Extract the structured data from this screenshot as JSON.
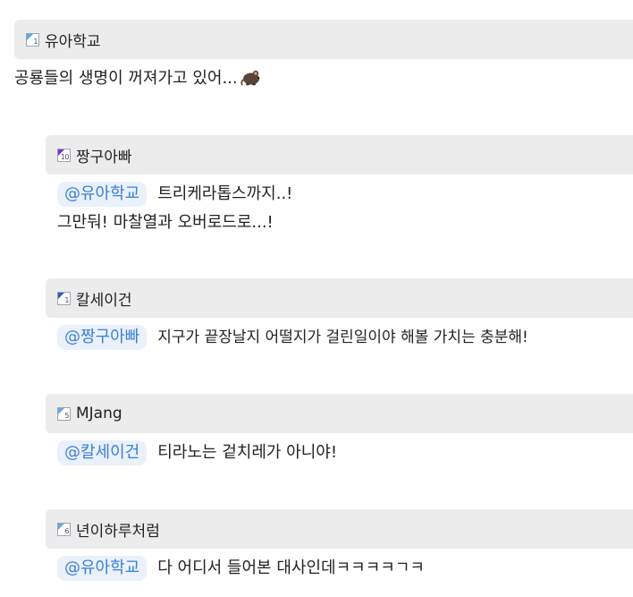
{
  "comments": [
    {
      "nick": "유아학교",
      "level": "1",
      "level_color": "#55aaee",
      "lines": [
        "공룡들의 생명이 꺼져가고 있어..."
      ],
      "emoji": "mouse-emoji"
    },
    {
      "nick": "짱구아빠",
      "level": "10",
      "level_color": "#7a2fd6",
      "mention": "@유아학교",
      "lines": [
        "트리케라톱스까지..!",
        "그만둬! 마찰열과 오버로드로...!"
      ]
    },
    {
      "nick": "칼세이건",
      "level": "1",
      "level_color": "#2f5fa8",
      "mention": "@짱구아빠",
      "lines": [
        "지구가 끝장날지 어떨지가 걸린일이야 해볼 가치는 충분해!"
      ]
    },
    {
      "nick": "MJang",
      "level": "5",
      "level_color": "#6aa6e0",
      "mention": "@칼세이건",
      "lines": [
        "티라노는 겉치레가 아니야!"
      ]
    },
    {
      "nick": "년이하루처럼",
      "level": "6",
      "level_color": "#6aa6e0",
      "mention": "@유아학교",
      "lines": [
        "다 어디서 들어본 대사인데ㅋㅋㅋㅋㄱㅋ"
      ]
    }
  ]
}
